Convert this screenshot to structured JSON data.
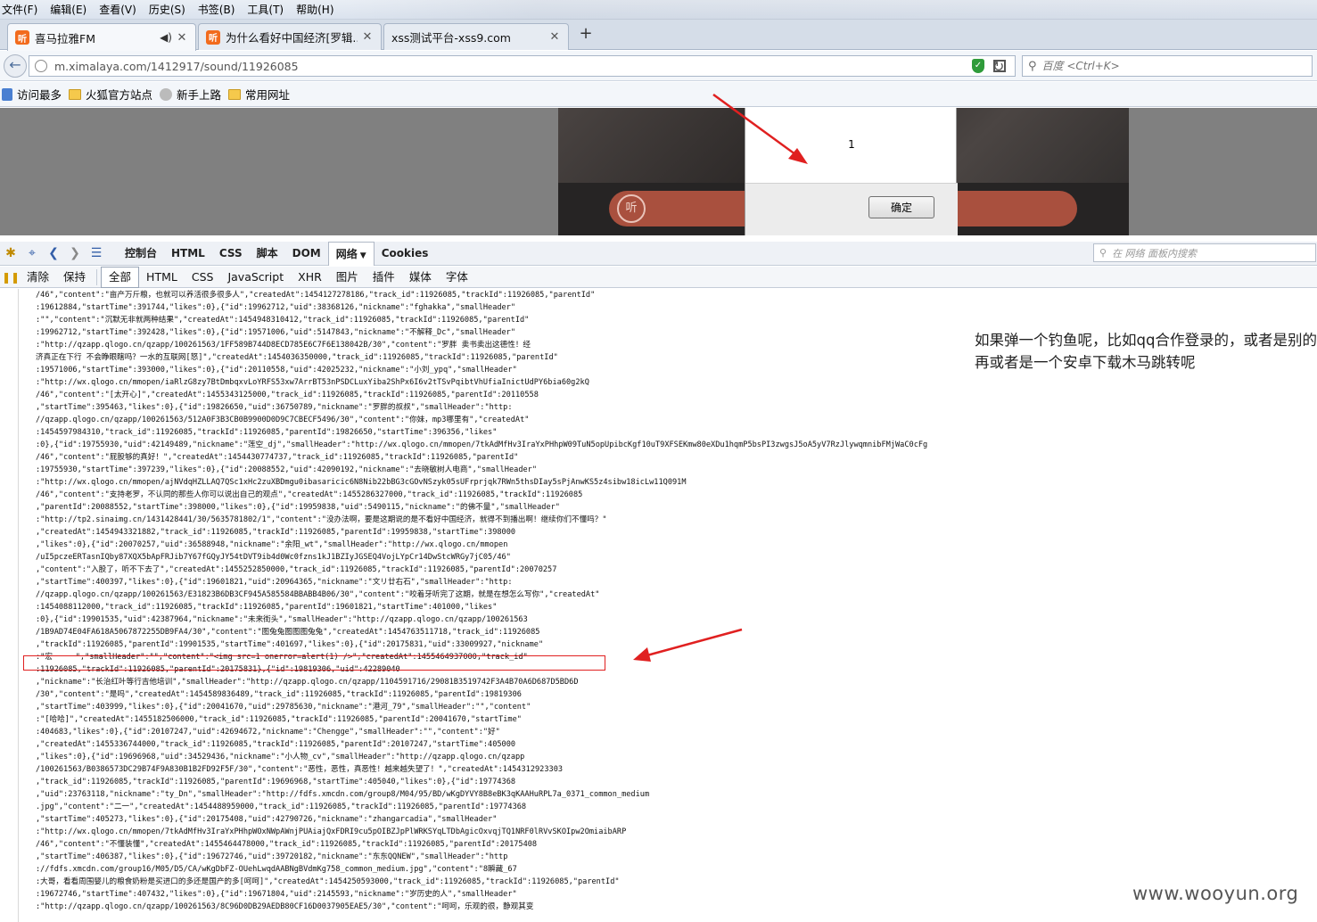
{
  "menubar": {
    "items": [
      "文件(F)",
      "编辑(E)",
      "查看(V)",
      "历史(S)",
      "书签(B)",
      "工具(T)",
      "帮助(H)"
    ]
  },
  "tabs": [
    {
      "label": "喜马拉雅FM",
      "icon": "ximalaya-favicon"
    },
    {
      "label": "为什么看好中国经济[罗辑...",
      "icon": "ximalaya-favicon"
    },
    {
      "label": "xss测试平台-xss9.com",
      "icon": "none"
    }
  ],
  "navbar": {
    "url": "m.ximalaya.com/1412917/sound/11926085",
    "search_placeholder": "百度 <Ctrl+K>"
  },
  "bookmarks": [
    "访问最多",
    "火狐官方站点",
    "新手上路",
    "常用网址"
  ],
  "page": {
    "play_icon_text": "听"
  },
  "dialog": {
    "message": "1",
    "ok_label": "确定"
  },
  "devtools": {
    "tabs": [
      "控制台",
      "HTML",
      "CSS",
      "脚本",
      "DOM",
      "网络",
      "Cookies"
    ],
    "selected_tab": "网络",
    "search_placeholder": "在 网络 面板内搜索",
    "filters": [
      "清除",
      "保持",
      "全部",
      "HTML",
      "CSS",
      "JavaScript",
      "XHR",
      "图片",
      "插件",
      "媒体",
      "字体"
    ],
    "selected_filter": "全部"
  },
  "response_lines": [
    "/46\",\"content\":\"亩产万斤粮，也就可以养活很多很多人\",\"createdAt\":1454127278186,\"track_id\":11926085,\"trackId\":11926085,\"parentId\"",
    ":19612884,\"startTime\":391744,\"likes\":0},{\"id\":19962712,\"uid\":38368126,\"nickname\":\"fghakka\",\"smallHeader\"",
    ":\"\",\"content\":\"沉默无非就两种结果\",\"createdAt\":1454948310412,\"track_id\":11926085,\"trackId\":11926085,\"parentId\"",
    ":19962712,\"startTime\":392428,\"likes\":0},{\"id\":19571006,\"uid\":5147843,\"nickname\":\"不解释_Dc\",\"smallHeader\"",
    ":\"http://qzapp.qlogo.cn/qzapp/100261563/1FF589B744D8ECD785E6C7F6E138042B/30\",\"content\":\"罗胖 卖书卖出这德性！经",
    "济真正在下行 不会睁眼瞎吗？一水的互联网[怒]\",\"createdAt\":1454036350000,\"track_id\":11926085,\"trackId\":11926085,\"parentId\"",
    ":19571006,\"startTime\":393000,\"likes\":0},{\"id\":20110558,\"uid\":42025232,\"nickname\":\"小刘_ypq\",\"smallHeader\"",
    ":\"http://wx.qlogo.cn/mmopen/iaRlzG8zy7BtDmbqxvLoYRFS53xw7ArrBT53nPSDCLuxYiba2ShPx6I6v2tTSvPqibtVhUfiaInictUdPY6bia60g2kQ",
    "/46\",\"content\":\"[太开心]\",\"createdAt\":1455343125000,\"track_id\":11926085,\"trackId\":11926085,\"parentId\":20110558",
    ",\"startTime\":395463,\"likes\":0},{\"id\":19826650,\"uid\":36750789,\"nickname\":\"罗胖的叔叔\",\"smallHeader\":\"http:",
    "//qzapp.qlogo.cn/qzapp/100261563/512A0F3B3CB0B9900D0D9C7CBECF5496/30\",\"content\":\"你妹，mp3哪里有\",\"createdAt\"",
    ":1454597984310,\"track_id\":11926085,\"trackId\":11926085,\"parentId\":19826650,\"startTime\":396356,\"likes\"",
    ":0},{\"id\":19755930,\"uid\":42149489,\"nickname\":\"莲空_dj\",\"smallHeader\":\"http://wx.qlogo.cn/mmopen/7tkAdMfHv3IraYxPHhpW09TuN5opUpibcKgf10uT9XFSEKmw80eXDu1hqmP5bsPI3zwgsJ5oA5yV7RzJlywqmnibFMjWaC0cFg",
    "/46\",\"content\":\"屁股够的真好！\",\"createdAt\":1454430774737,\"track_id\":11926085,\"trackId\":11926085,\"parentId\"",
    ":19755930,\"startTime\":397239,\"likes\":0},{\"id\":20088552,\"uid\":42090192,\"nickname\":\"去晓敏树人电商\",\"smallHeader\"",
    ":\"http://wx.qlogo.cn/mmopen/ajNVdqHZLLAQ7QSc1xHc2zuXBDmgu0ibasaricic6N8Nib22bBG3cGOvNSzyk05sUFrprjqk7RWn5thsDIay5sPjAnwKS5z4sibw18icLw11Q091M",
    "/46\",\"content\":\"支持老罗，不认同的那些人你可以说出自己的观点\",\"createdAt\":1455286327000,\"track_id\":11926085,\"trackId\":11926085",
    ",\"parentId\":20088552,\"startTime\":398000,\"likes\":0},{\"id\":19959838,\"uid\":5490115,\"nickname\":\"的佛不量\",\"smallHeader\"",
    ":\"http://tp2.sinaimg.cn/1431428441/30/5635781802/1\",\"content\":\"没办法啊，要是这期说的是不看好中国经济，就得不到播出啊！继续你们不懂吗？\"",
    ",\"createdAt\":1454943321882,\"track_id\":11926085,\"trackId\":11926085,\"parentId\":19959838,\"startTime\":398000",
    ",\"likes\":0},{\"id\":20070257,\"uid\":36588948,\"nickname\":\"余阳_wt\",\"smallHeader\":\"http://wx.qlogo.cn/mmopen",
    "/uI5pczeERTasnIQby87XQX5bApFRJib7Y67fGQyJY54tDVT9ib4d0Wc0fzns1kJ1BZIyJGSEQ4VojLYpCr14DwStcWRGy7jC05/46\"",
    ",\"content\":\"入股了，听不下去了\",\"createdAt\":1455252850000,\"track_id\":11926085,\"trackId\":11926085,\"parentId\":20070257",
    ",\"startTime\":400397,\"likes\":0},{\"id\":19601821,\"uid\":20964365,\"nickname\":\"文リ廿右石\",\"smallHeader\":\"http:",
    "//qzapp.qlogo.cn/qzapp/100261563/E31823B6DB3CF945A585584BBABB4B06/30\",\"content\":\"咬着牙听完了这期，就是在想怎么写你\",\"createdAt\"",
    ":1454088112000,\"track_id\":11926085,\"trackId\":11926085,\"parentId\":19601821,\"startTime\":401000,\"likes\"",
    ":0},{\"id\":19901535,\"uid\":42387964,\"nickname\":\"未来街头\",\"smallHeader\":\"http://qzapp.qlogo.cn/qzapp/100261563",
    "/1B9AD74E04FA618A5067872255DB9FA4/30\",\"content\":\"图兔兔图图图兔兔\",\"createdAt\":1454763511718,\"track_id\":11926085",
    ",\"trackId\":11926085,\"parentId\":19901535,\"startTime\":401697,\"likes\":0},{\"id\":20175831,\"uid\":33009927,\"nickname\"",
    ":\"宏　　　\",\"smallHeader\":\"\",\"content\":\"<img src=1 onerror=alert(1) />\",\"createdAt\":1455464937000,\"track_id\"",
    ":11926085,\"trackId\":11926085,\"parentId\":20175831},{\"id\":19819306,\"uid\":42289040",
    ",\"nickname\":\"长治红叶等行吉他培训\",\"smallHeader\":\"http://qzapp.qlogo.cn/qzapp/1104591716/29081B3519742F3A4B70A6D687D5BD6D",
    "/30\",\"content\":\"是吗\",\"createdAt\":1454589836489,\"track_id\":11926085,\"trackId\":11926085,\"parentId\":19819306",
    ",\"startTime\":403999,\"likes\":0},{\"id\":20041670,\"uid\":29785630,\"nickname\":\"港河_79\",\"smallHeader\":\"\",\"content\"",
    ":\"[哈哈]\",\"createdAt\":1455182506000,\"track_id\":11926085,\"trackId\":11926085,\"parentId\":20041670,\"startTime\"",
    ":404683,\"likes\":0},{\"id\":20107247,\"uid\":42694672,\"nickname\":\"Chengge\",\"smallHeader\":\"\",\"content\":\"好\"",
    ",\"createdAt\":1455336744000,\"track_id\":11926085,\"trackId\":11926085,\"parentId\":20107247,\"startTime\":405000",
    ",\"likes\":0},{\"id\":19696968,\"uid\":34529436,\"nickname\":\"小人物_cv\",\"smallHeader\":\"http://qzapp.qlogo.cn/qzapp",
    "/100261563/B0386573DC29B74F9A830B1B2FD92F5F/30\",\"content\":\"恶性，恶性，真恶性！越来越失望了！\",\"createdAt\":1454312923303",
    ",\"track_id\":11926085,\"trackId\":11926085,\"parentId\":19696968,\"startTime\":405040,\"likes\":0},{\"id\":19774368",
    ",\"uid\":23763118,\"nickname\":\"ty_Dn\",\"smallHeader\":\"http://fdfs.xmcdn.com/group8/M04/95/BD/wKgDYVY8B8eBK3qKAAHuRPL7a_0371_common_medium",
    ".jpg\",\"content\":\"二一\",\"createdAt\":1454488959000,\"track_id\":11926085,\"trackId\":11926085,\"parentId\":19774368",
    ",\"startTime\":405273,\"likes\":0},{\"id\":20175408,\"uid\":42790726,\"nickname\":\"zhangarcadia\",\"smallHeader\"",
    ":\"http://wx.qlogo.cn/mmopen/7tkAdMfHv3IraYxPHhpWOxNWpAWnjPUAiajQxFDRI9cu5pOIBZJpPlWRKSYqLTDbAgicOxvqjTQ1NRF0lRVvSKOIpw2OmiaibARP",
    "/46\",\"content\":\"不懂装懂\",\"createdAt\":1455464478000,\"track_id\":11926085,\"trackId\":11926085,\"parentId\":20175408",
    ",\"startTime\":406387,\"likes\":0},{\"id\":19672746,\"uid\":39720182,\"nickname\":\"东东QQNEW\",\"smallHeader\":\"http",
    "://fdfs.xmcdn.com/group16/M05/D5/CA/wKgDbFZ-OUehLwqdAABNgBVdmKg758_common_medium.jpg\",\"content\":\"8瞬藏_67",
    ":大哥，看看周围婴儿的粮食奶粉是买进口的多还是国产的多[呵呵]\",\"createdAt\":1454250593000,\"track_id\":11926085,\"trackId\":11926085,\"parentId\"",
    ":19672746,\"startTime\":407432,\"likes\":0},{\"id\":19671804,\"uid\":2145593,\"nickname\":\"岁历史的人\",\"smallHeader\"",
    ":\"http://qzapp.qlogo.cn/qzapp/100261563/8C96D0DB29AEDB80CF16D0037905EAE5/30\",\"content\":\"呵呵，乐观的很，静观其变"
  ],
  "annotation": {
    "note": "如果弹一个钓鱼呢，比如qq合作登录的，或者是别的 再或者是一个安卓下载木马跳转呢",
    "watermark": "www.wooyun.org",
    "highlight_color": "#e02020"
  }
}
